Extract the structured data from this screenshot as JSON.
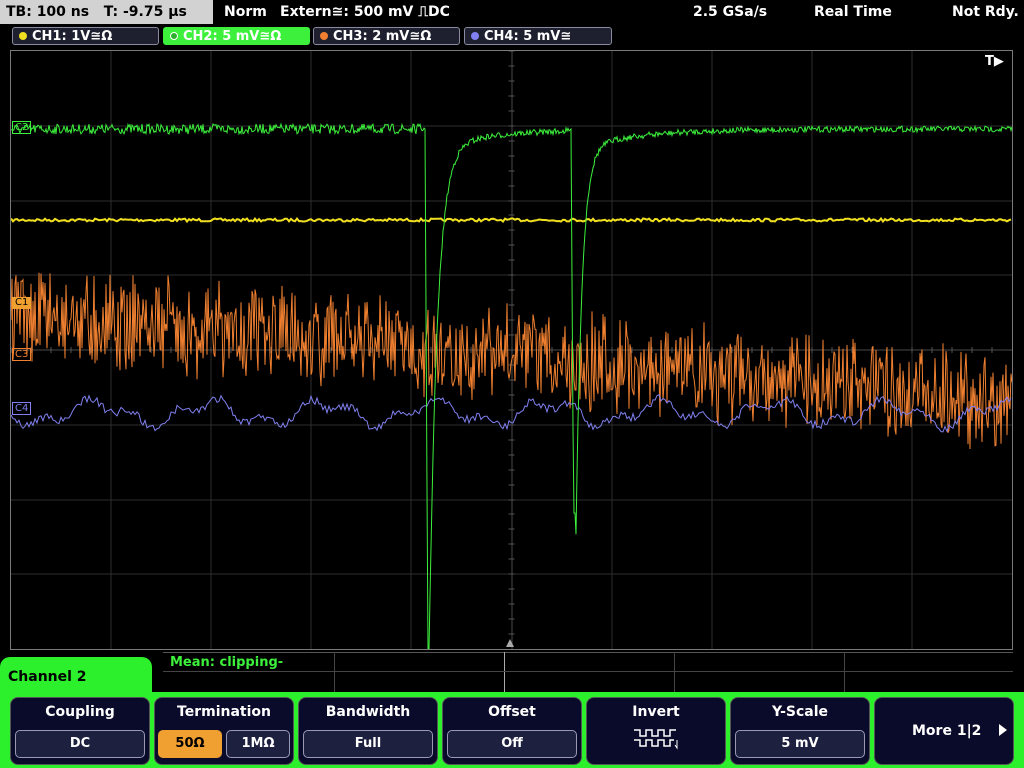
{
  "topbar": {
    "timebase": "TB: 100 ns",
    "trigger_time": "T: -9.75 µs",
    "mode": "Norm",
    "trigger_source": "Extern≅: 500 mV ⎍DC",
    "sample_rate": "2.5 GSa/s",
    "acq_mode": "Real Time",
    "status": "Not Rdy."
  },
  "channels": [
    {
      "label": "CH1: 1V≅Ω",
      "color": "#f0e020"
    },
    {
      "label": "CH2: 5 mV≅Ω",
      "color": "#3cf03c"
    },
    {
      "label": "CH3: 2 mV≅Ω",
      "color": "#f08030"
    },
    {
      "label": "CH4: 5 mV≅",
      "color": "#8080f0"
    }
  ],
  "screen": {
    "trigger_marker": "T▶",
    "markers": {
      "c2": "C2",
      "c1": "C1",
      "c3": "C3",
      "c4": "C4"
    }
  },
  "measurement": {
    "text": "Mean: clipping-"
  },
  "menu": {
    "title": "Channel 2",
    "coupling": {
      "title": "Coupling",
      "value": "DC"
    },
    "termination": {
      "title": "Termination",
      "opt1": "50Ω",
      "opt2": "1MΩ"
    },
    "bandwidth": {
      "title": "Bandwidth",
      "value": "Full"
    },
    "offset": {
      "title": "Offset",
      "value": "Off"
    },
    "invert": {
      "title": "Invert",
      "icon": "square-wave-icon"
    },
    "yscale": {
      "title": "Y-Scale",
      "value": "5 mV"
    },
    "more": {
      "label": "More 1|2"
    }
  }
}
